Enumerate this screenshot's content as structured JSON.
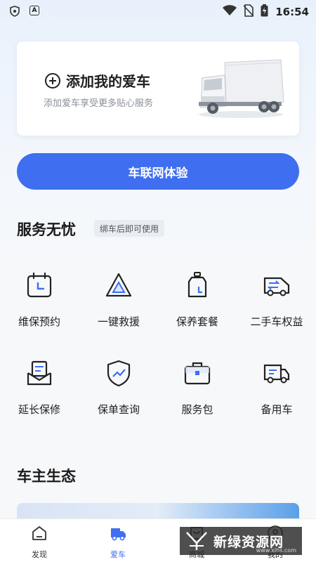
{
  "status_bar": {
    "time": "16:54",
    "left_icons": [
      "shield-icon",
      "a-icon"
    ],
    "right_icons": [
      "wifi-icon",
      "no-sim-icon",
      "battery-icon"
    ]
  },
  "add_car": {
    "title": "添加我的爱车",
    "subtitle": "添加爱车享受更多贴心服务"
  },
  "iov_button": "车联网体验",
  "services": {
    "title": "服务无忧",
    "tag": "绑车后即可使用",
    "items": [
      {
        "label": "维保预约",
        "icon": "calendar-icon"
      },
      {
        "label": "一键救援",
        "icon": "warning-triangle-icon"
      },
      {
        "label": "保养套餐",
        "icon": "oil-bottle-icon"
      },
      {
        "label": "二手车权益",
        "icon": "van-swap-icon"
      },
      {
        "label": "延长保修",
        "icon": "mail-doc-icon"
      },
      {
        "label": "保单查询",
        "icon": "shield-chart-icon"
      },
      {
        "label": "服务包",
        "icon": "briefcase-icon"
      },
      {
        "label": "备用车",
        "icon": "truck-icon"
      }
    ]
  },
  "ecosystem": {
    "title": "车主生态"
  },
  "bottom_nav": [
    {
      "label": "发现",
      "icon": "discover-icon",
      "active": false
    },
    {
      "label": "爱车",
      "icon": "car-icon",
      "active": true
    },
    {
      "label": "商城",
      "icon": "mall-icon",
      "active": false
    },
    {
      "label": "我的",
      "icon": "profile-icon",
      "active": false
    }
  ],
  "watermark": {
    "text": "新绿资源网",
    "url": "www.xlhs.com"
  },
  "colors": {
    "accent": "#3f6ef0",
    "tag_bg": "#e9edf3"
  }
}
